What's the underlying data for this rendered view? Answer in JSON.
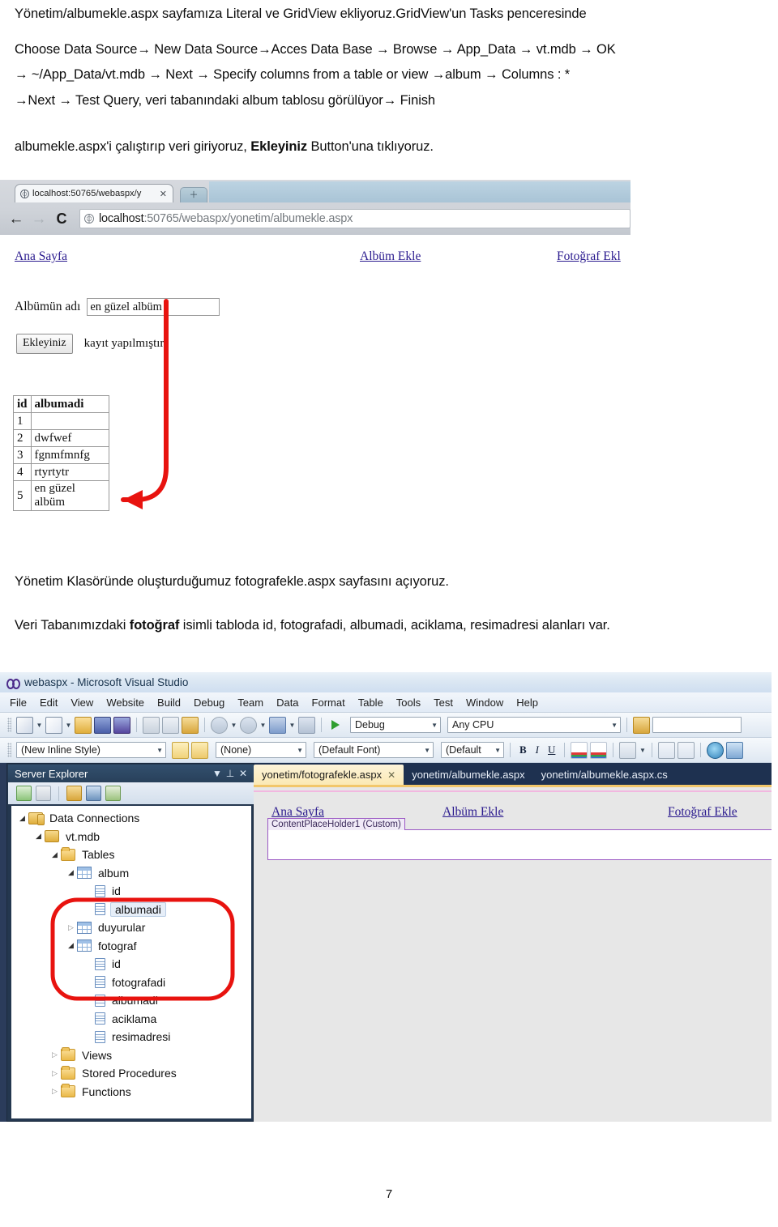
{
  "document": {
    "intro": "Yönetim/albumekle.aspx sayfamıza Literal ve GridView ekliyoruz.GridView'un Tasks penceresinde",
    "steps_line1": "Choose Data Source→ New Data Source→Acces Data Base → Browse →  App_Data  → vt.mdb → OK",
    "steps_line2": "→ ~/App_Data/vt.mdb → Next → Specify columns from a table or view  →album →  Columns :  *",
    "steps_line3": "→Next → Test Query,  veri tabanındaki album tablosu görülüyor→ Finish",
    "run_prefix": "albumekle.aspx'i çalıştırıp veri giriyoruz, ",
    "run_bold": "Ekleyiniz",
    "run_suffix": " Button'una tıklıyoruz.",
    "open_page": "Yönetim Klasöründe oluşturduğumuz fotografekle.aspx sayfasını açıyoruz.",
    "fields_prefix": "Veri Tabanımızdaki ",
    "fields_bold": "fotoğraf",
    "fields_suffix": " isimli tabloda id, fotografadi, albumadi, aciklama, resimadresi  alanları var.",
    "page_number": "7"
  },
  "browser": {
    "tab_title": "localhost:50765/webaspx/y",
    "tab_close_icon": "close-icon",
    "new_tab_icon": "plus-icon",
    "back_icon": "←",
    "forward_icon": "→",
    "reload_icon": "C",
    "url_host": "localhost",
    "url_rest": ":50765/webaspx/yonetim/albumekle.aspx",
    "nav": {
      "home": "Ana Sayfa",
      "album_add": "Albüm Ekle",
      "photo_add": "Fotoğraf Ekl"
    },
    "form": {
      "label": "Albümün adı",
      "input_value": "en güzel albüm",
      "input_placeholder": "",
      "submit_label": "Ekleyiniz",
      "status": "kayıt yapılmıştır"
    },
    "gridview": {
      "columns": [
        "id",
        "albumadi"
      ],
      "rows": [
        [
          "1",
          ""
        ],
        [
          "2",
          "dwfwef"
        ],
        [
          "3",
          "fgnmfmnfg"
        ],
        [
          "4",
          "rtyrtytr"
        ],
        [
          "5",
          "en güzel albüm"
        ]
      ]
    },
    "annotation_color": "#e8130f"
  },
  "vs": {
    "title": "webaspx - Microsoft Visual Studio",
    "menus": [
      "File",
      "Edit",
      "View",
      "Website",
      "Build",
      "Debug",
      "Team",
      "Data",
      "Format",
      "Table",
      "Tools",
      "Test",
      "Window",
      "Help"
    ],
    "toolbar_standard": {
      "config": "Debug",
      "platform": "Any CPU",
      "find_value": "",
      "find_placeholder": ""
    },
    "toolbar_formatting": {
      "style": "(New Inline Style)",
      "class": "(None)",
      "font": "(Default Font)",
      "size": "(Default",
      "bold": "B",
      "italic": "I",
      "underline": "U"
    },
    "server_explorer": {
      "title": "Server Explorer",
      "dropdown_icon": "chevron-down-icon",
      "pin_icon": "pin-icon",
      "close_icon": "close-icon",
      "tree": [
        {
          "label": "Data Connections",
          "icon": "connections-icon",
          "depth": 0,
          "state": "open"
        },
        {
          "label": "vt.mdb",
          "icon": "database-icon",
          "depth": 1,
          "state": "open"
        },
        {
          "label": "Tables",
          "icon": "folder-icon",
          "depth": 2,
          "state": "open"
        },
        {
          "label": "album",
          "icon": "table-icon",
          "depth": 3,
          "state": "open"
        },
        {
          "label": "id",
          "icon": "column-icon",
          "depth": 4,
          "state": "leaf"
        },
        {
          "label": "albumadi",
          "icon": "column-icon",
          "depth": 4,
          "state": "leaf",
          "selected": true
        },
        {
          "label": "duyurular",
          "icon": "table-icon",
          "depth": 3,
          "state": "closed"
        },
        {
          "label": "fotograf",
          "icon": "table-icon",
          "depth": 3,
          "state": "open"
        },
        {
          "label": "id",
          "icon": "column-icon",
          "depth": 4,
          "state": "leaf"
        },
        {
          "label": "fotografadi",
          "icon": "column-icon",
          "depth": 4,
          "state": "leaf"
        },
        {
          "label": "albumadi",
          "icon": "column-icon",
          "depth": 4,
          "state": "leaf"
        },
        {
          "label": "aciklama",
          "icon": "column-icon",
          "depth": 4,
          "state": "leaf"
        },
        {
          "label": "resimadresi",
          "icon": "column-icon",
          "depth": 4,
          "state": "leaf"
        },
        {
          "label": "Views",
          "icon": "folder-icon",
          "depth": 2,
          "state": "closed"
        },
        {
          "label": "Stored Procedures",
          "icon": "folder-icon",
          "depth": 2,
          "state": "closed"
        },
        {
          "label": "Functions",
          "icon": "folder-icon",
          "depth": 2,
          "state": "closed"
        }
      ]
    },
    "editor_tabs": [
      {
        "label": "yonetim/fotografekle.aspx",
        "active": true,
        "close_icon": "close-icon"
      },
      {
        "label": "yonetim/albumekle.aspx",
        "active": false
      },
      {
        "label": "yonetim/albumekle.aspx.cs",
        "active": false
      }
    ],
    "designer": {
      "nav": {
        "home": "Ana Sayfa",
        "album_add": "Albüm Ekle",
        "photo_add": "Fotoğraf Ekle"
      },
      "content_placeholder": "ContentPlaceHolder1 (Custom)"
    },
    "annotation_color": "#e8130f"
  }
}
